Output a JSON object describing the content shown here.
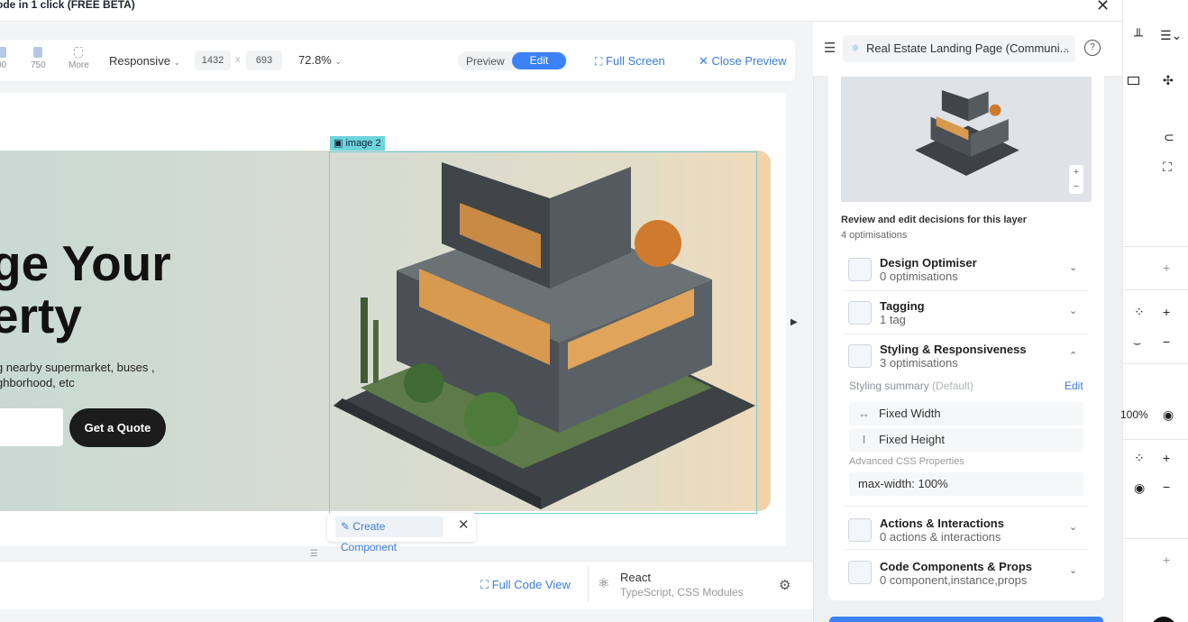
{
  "title_bar": {
    "title": "ode in 1 click (FREE BETA)"
  },
  "toolbar": {
    "devices": [
      {
        "label": "00"
      },
      {
        "label": "750"
      },
      {
        "label": "More"
      }
    ],
    "responsive_label": "Responsive",
    "width_value": "1432",
    "times": "x",
    "height_value": "693",
    "zoom": "72.8%",
    "preview_label": "Preview",
    "edit_label": "Edit",
    "full_screen_label": "Full Screen",
    "close_preview_label": "Close Preview"
  },
  "canvas": {
    "headline": "ge Your\nerty",
    "subtext": "g nearby supermarket, buses ,\nghborhood, etc",
    "quote_button": "Get a Quote",
    "selection_label": "image 2",
    "create_component_label": "Create Component"
  },
  "bottom_bar": {
    "full_code_label": "Full Code View",
    "framework": "React",
    "framework_sub": "TypeScript, CSS Modules"
  },
  "panel": {
    "project": "Real Estate Landing Page (Communi...",
    "review_title": "Review and edit decisions for this layer",
    "review_count": "4 optimisations",
    "sections": [
      {
        "title": "Design Optimiser",
        "sub": "0 optimisations"
      },
      {
        "title": "Tagging",
        "sub": "1 tag"
      },
      {
        "title": "Styling & Responsiveness",
        "sub": "3 optimisations"
      },
      {
        "title": "Actions & Interactions",
        "sub": "0 actions & interactions"
      },
      {
        "title": "Code Components & Props",
        "sub": "0 component,instance,props"
      }
    ],
    "styling_summary": "Styling summary",
    "styling_default": "(Default)",
    "edit_link": "Edit",
    "fixed_width": "Fixed Width",
    "fixed_height": "Fixed Height",
    "advanced_css": "Advanced CSS Properties",
    "max_width": "max-width: 100%"
  },
  "rail": {
    "percent": "100%"
  },
  "colors": {
    "accent": "#3b82f6",
    "selection": "#6fd3dc",
    "link": "#3b7ddd"
  }
}
